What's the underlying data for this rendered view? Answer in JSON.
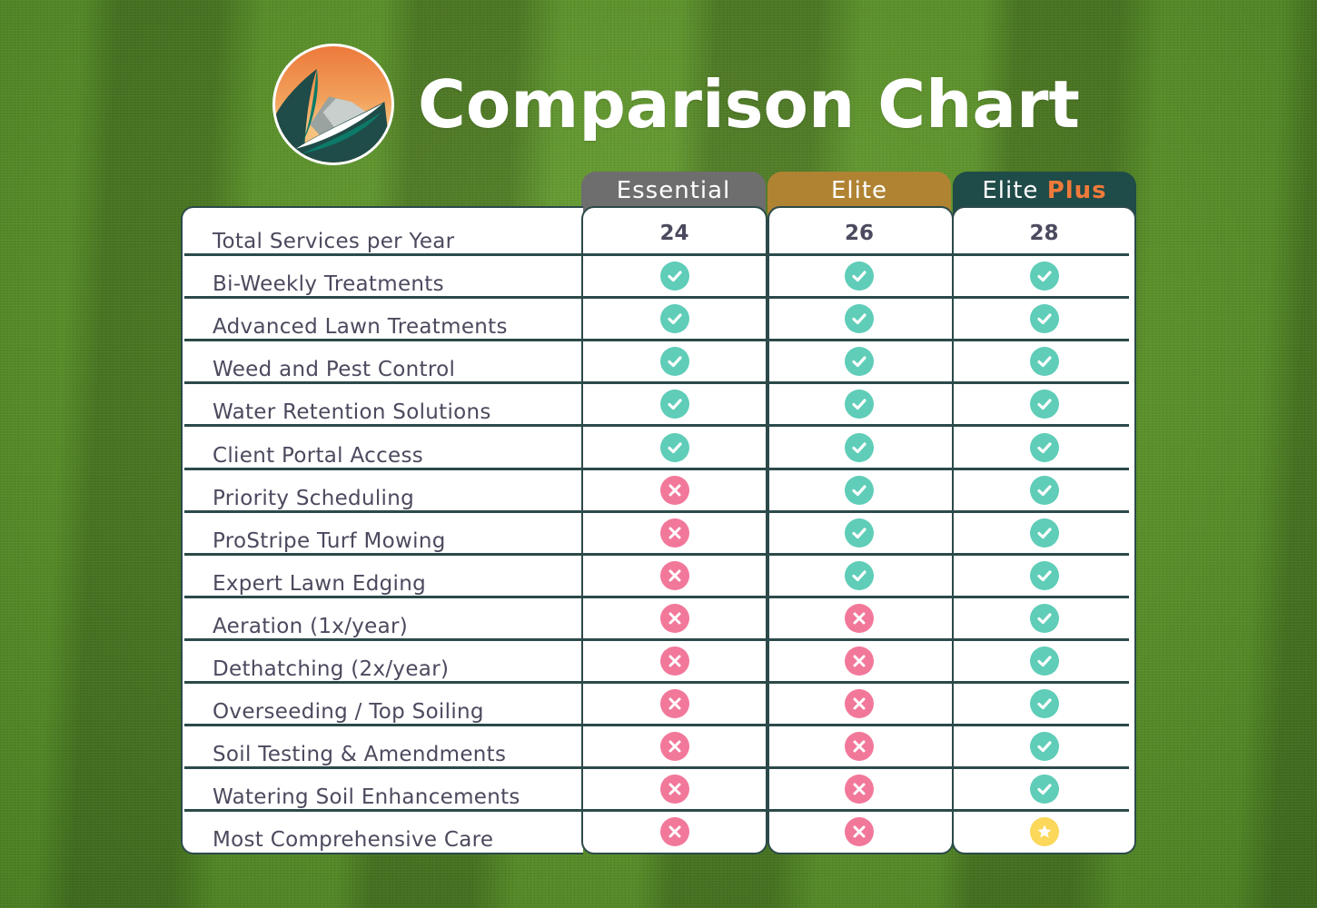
{
  "header": {
    "title": "Comparison Chart",
    "logo_icon": "leaf-mountain-sunset-logo"
  },
  "colors": {
    "essential": "#6e6e6e",
    "elite": "#b08333",
    "elite_plus": "#1f4b48",
    "plus_accent": "#f07a3a",
    "check": "#5fcdb8",
    "cross": "#f2789a",
    "star": "#fbd75a",
    "border": "#2c4a4a",
    "text": "#4b4a5e"
  },
  "tiers": [
    {
      "name": "Essential",
      "suffix": ""
    },
    {
      "name": "Elite",
      "suffix": ""
    },
    {
      "name": "Elite",
      "suffix": "Plus"
    }
  ],
  "rows": [
    {
      "label": "Total Services per Year",
      "values": [
        "24",
        "26",
        "28"
      ]
    },
    {
      "label": "Bi-Weekly Treatments",
      "values": [
        "check",
        "check",
        "check"
      ]
    },
    {
      "label": "Advanced Lawn Treatments",
      "values": [
        "check",
        "check",
        "check"
      ]
    },
    {
      "label": "Weed and Pest Control",
      "values": [
        "check",
        "check",
        "check"
      ]
    },
    {
      "label": "Water Retention Solutions",
      "values": [
        "check",
        "check",
        "check"
      ]
    },
    {
      "label": "Client Portal Access",
      "values": [
        "check",
        "check",
        "check"
      ]
    },
    {
      "label": "Priority Scheduling",
      "values": [
        "cross",
        "check",
        "check"
      ]
    },
    {
      "label": "ProStripe Turf Mowing",
      "values": [
        "cross",
        "check",
        "check"
      ]
    },
    {
      "label": "Expert Lawn Edging",
      "values": [
        "cross",
        "check",
        "check"
      ]
    },
    {
      "label": "Aeration (1x/year)",
      "values": [
        "cross",
        "cross",
        "check"
      ]
    },
    {
      "label": "Dethatching (2x/year)",
      "values": [
        "cross",
        "cross",
        "check"
      ]
    },
    {
      "label": "Overseeding / Top Soiling",
      "values": [
        "cross",
        "cross",
        "check"
      ]
    },
    {
      "label": "Soil Testing & Amendments",
      "values": [
        "cross",
        "cross",
        "check"
      ]
    },
    {
      "label": "Watering Soil Enhancements",
      "values": [
        "cross",
        "cross",
        "check"
      ]
    },
    {
      "label": "Most Comprehensive Care",
      "values": [
        "cross",
        "cross",
        "star"
      ]
    }
  ]
}
